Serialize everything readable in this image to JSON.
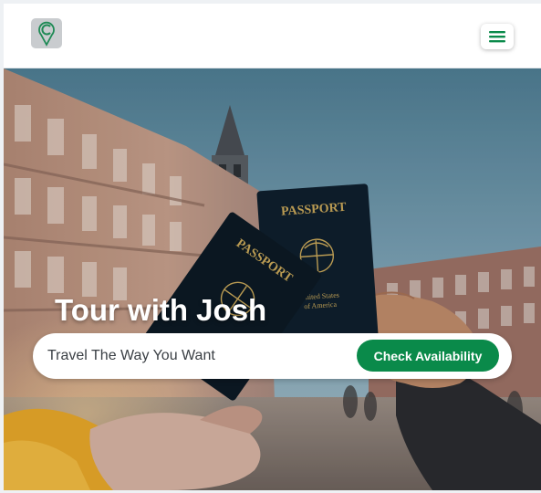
{
  "header": {
    "logo_icon": "map-pin-logo-icon",
    "menu_icon": "hamburger-menu-icon"
  },
  "hero": {
    "title": "Tour with Josh",
    "search": {
      "placeholder": "Travel The Way You Want",
      "value": ""
    },
    "cta_label": "Check Availability",
    "image_text": {
      "passport_left": "PASSPORT",
      "passport_right": "PASSPORT",
      "country_line1": "United States",
      "country_line2": "of America"
    }
  },
  "colors": {
    "brand_green": "#0a8a4a",
    "header_bg": "#ffffff",
    "logo_bg": "#c9cccf",
    "passport_gold": "#c9a85a",
    "passport_navy": "#0d1d2b"
  }
}
